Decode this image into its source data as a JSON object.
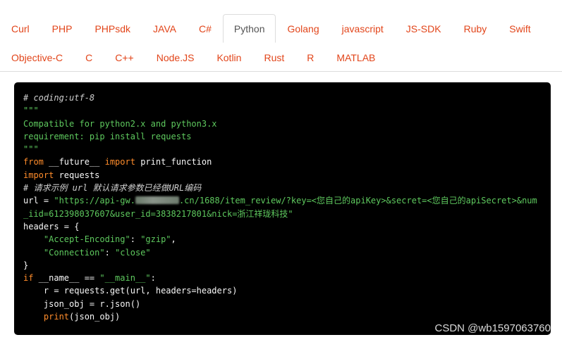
{
  "tabs": {
    "row1": [
      "Curl",
      "PHP",
      "PHPsdk",
      "JAVA",
      "C#",
      "Python",
      "Golang",
      "javascript",
      "JS-SDK",
      "Ruby",
      "Swift"
    ],
    "row2": [
      "Objective-C",
      "C",
      "C++",
      "Node.JS",
      "Kotlin",
      "Rust",
      "R",
      "MATLAB"
    ],
    "active": "Python"
  },
  "code": {
    "l1": "# coding:utf-8",
    "l2": "\"\"\"",
    "l3": "Compatible for python2.x and python3.x",
    "l4": "requirement: pip install requests",
    "l5": "\"\"\"",
    "l6_kw1": "from",
    "l6_mod": " __future__ ",
    "l6_kw2": "import",
    "l6_name": " print_function",
    "l7_kw": "import",
    "l7_mod": " requests",
    "l8": "# 请求示例 url 默认请求参数已经做URL编码",
    "l9_var": "url = ",
    "l9_str_a": "\"https://api-gw.",
    "l9_str_b": ".cn/1688/item_review/?key=<您自己的apiKey>&secret=<您自己的apiSecret>&num",
    "l10_str": "_iid=612398037607&user_id=3838217801&nick=浙江祥珑科技\"",
    "l11": "headers = {",
    "l12_indent": "    ",
    "l12_key": "\"Accept-Encoding\"",
    "l12_colon": ": ",
    "l12_val": "\"gzip\"",
    "l12_comma": ",",
    "l13_indent": "    ",
    "l13_key": "\"Connection\"",
    "l13_colon": ": ",
    "l13_val": "\"close\"",
    "l14": "}",
    "l15_kw": "if",
    "l15_mid": " __name__ == ",
    "l15_str": "\"__main__\"",
    "l15_end": ":",
    "l16": "    r = requests.get(url, headers=headers)",
    "l17": "    json_obj = r.json()",
    "l18_indent": "    ",
    "l18_kw": "print",
    "l18_rest": "(json_obj)"
  },
  "watermark": "CSDN @wb1597063760"
}
